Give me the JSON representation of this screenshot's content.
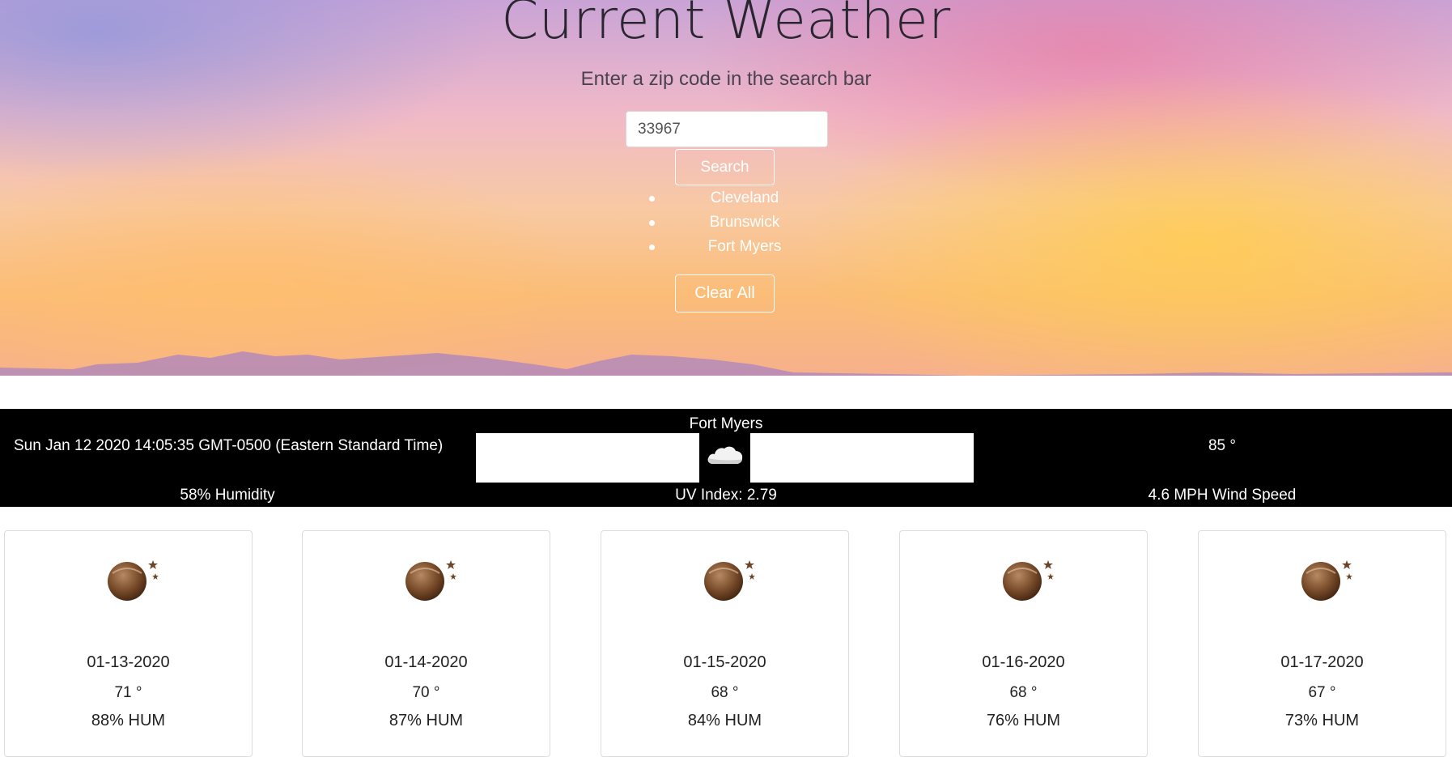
{
  "header": {
    "title": "Current Weather",
    "subtitle": "Enter a zip code in the search bar"
  },
  "search": {
    "value": "33967",
    "button_label": "Search"
  },
  "history": [
    "Cleveland",
    "Brunswick",
    "Fort Myers"
  ],
  "clear_label": "Clear All",
  "current": {
    "city": "Fort Myers",
    "datetime": "Sun Jan 12 2020 14:05:35 GMT-0500 (Eastern Standard Time)",
    "icon": "cloud-icon",
    "temp": "85 °",
    "humidity": "58% Humidity",
    "uv": "UV Index: 2.79",
    "wind": "4.6 MPH Wind Speed"
  },
  "forecast": [
    {
      "date": "01-13-2020",
      "temp": "71 °",
      "hum": "88% HUM",
      "icon": "moon-icon"
    },
    {
      "date": "01-14-2020",
      "temp": "70 °",
      "hum": "87% HUM",
      "icon": "moon-icon"
    },
    {
      "date": "01-15-2020",
      "temp": "68 °",
      "hum": "84% HUM",
      "icon": "moon-icon"
    },
    {
      "date": "01-16-2020",
      "temp": "68 °",
      "hum": "76% HUM",
      "icon": "moon-icon"
    },
    {
      "date": "01-17-2020",
      "temp": "67 °",
      "hum": "73% HUM",
      "icon": "moon-icon"
    }
  ],
  "colors": {
    "bar_background": "#000000",
    "card_border": "#dcdcdc",
    "title_color": "#2a2630"
  }
}
